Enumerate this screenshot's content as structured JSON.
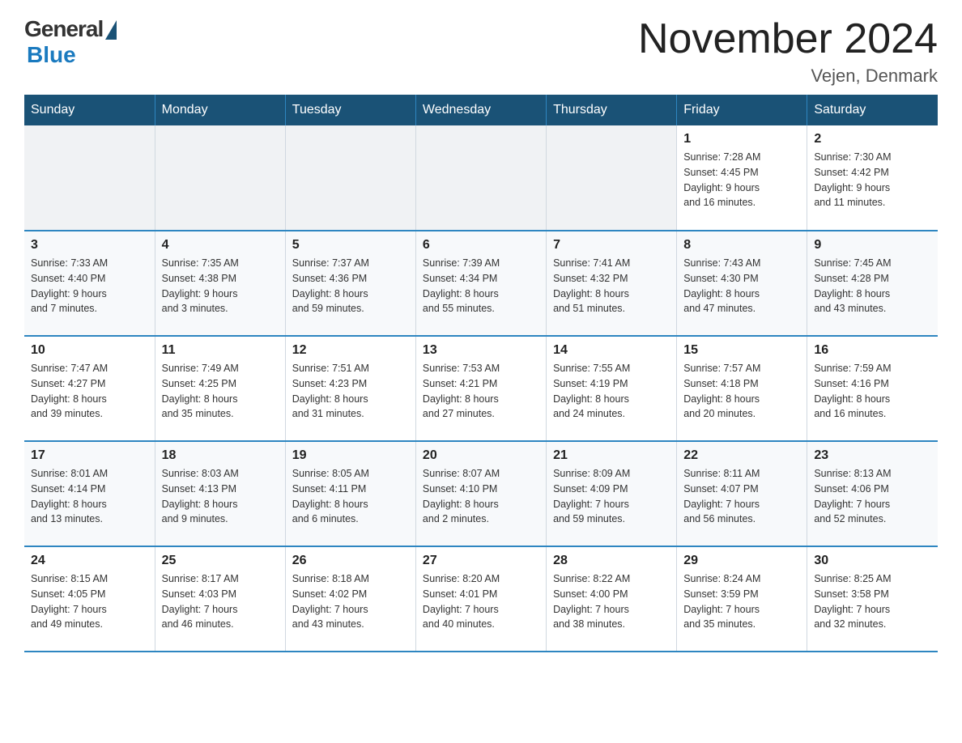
{
  "header": {
    "logo_general": "General",
    "logo_blue": "Blue",
    "title": "November 2024",
    "location": "Vejen, Denmark"
  },
  "days_of_week": [
    "Sunday",
    "Monday",
    "Tuesday",
    "Wednesday",
    "Thursday",
    "Friday",
    "Saturday"
  ],
  "weeks": [
    [
      {
        "day": "",
        "info": ""
      },
      {
        "day": "",
        "info": ""
      },
      {
        "day": "",
        "info": ""
      },
      {
        "day": "",
        "info": ""
      },
      {
        "day": "",
        "info": ""
      },
      {
        "day": "1",
        "info": "Sunrise: 7:28 AM\nSunset: 4:45 PM\nDaylight: 9 hours\nand 16 minutes."
      },
      {
        "day": "2",
        "info": "Sunrise: 7:30 AM\nSunset: 4:42 PM\nDaylight: 9 hours\nand 11 minutes."
      }
    ],
    [
      {
        "day": "3",
        "info": "Sunrise: 7:33 AM\nSunset: 4:40 PM\nDaylight: 9 hours\nand 7 minutes."
      },
      {
        "day": "4",
        "info": "Sunrise: 7:35 AM\nSunset: 4:38 PM\nDaylight: 9 hours\nand 3 minutes."
      },
      {
        "day": "5",
        "info": "Sunrise: 7:37 AM\nSunset: 4:36 PM\nDaylight: 8 hours\nand 59 minutes."
      },
      {
        "day": "6",
        "info": "Sunrise: 7:39 AM\nSunset: 4:34 PM\nDaylight: 8 hours\nand 55 minutes."
      },
      {
        "day": "7",
        "info": "Sunrise: 7:41 AM\nSunset: 4:32 PM\nDaylight: 8 hours\nand 51 minutes."
      },
      {
        "day": "8",
        "info": "Sunrise: 7:43 AM\nSunset: 4:30 PM\nDaylight: 8 hours\nand 47 minutes."
      },
      {
        "day": "9",
        "info": "Sunrise: 7:45 AM\nSunset: 4:28 PM\nDaylight: 8 hours\nand 43 minutes."
      }
    ],
    [
      {
        "day": "10",
        "info": "Sunrise: 7:47 AM\nSunset: 4:27 PM\nDaylight: 8 hours\nand 39 minutes."
      },
      {
        "day": "11",
        "info": "Sunrise: 7:49 AM\nSunset: 4:25 PM\nDaylight: 8 hours\nand 35 minutes."
      },
      {
        "day": "12",
        "info": "Sunrise: 7:51 AM\nSunset: 4:23 PM\nDaylight: 8 hours\nand 31 minutes."
      },
      {
        "day": "13",
        "info": "Sunrise: 7:53 AM\nSunset: 4:21 PM\nDaylight: 8 hours\nand 27 minutes."
      },
      {
        "day": "14",
        "info": "Sunrise: 7:55 AM\nSunset: 4:19 PM\nDaylight: 8 hours\nand 24 minutes."
      },
      {
        "day": "15",
        "info": "Sunrise: 7:57 AM\nSunset: 4:18 PM\nDaylight: 8 hours\nand 20 minutes."
      },
      {
        "day": "16",
        "info": "Sunrise: 7:59 AM\nSunset: 4:16 PM\nDaylight: 8 hours\nand 16 minutes."
      }
    ],
    [
      {
        "day": "17",
        "info": "Sunrise: 8:01 AM\nSunset: 4:14 PM\nDaylight: 8 hours\nand 13 minutes."
      },
      {
        "day": "18",
        "info": "Sunrise: 8:03 AM\nSunset: 4:13 PM\nDaylight: 8 hours\nand 9 minutes."
      },
      {
        "day": "19",
        "info": "Sunrise: 8:05 AM\nSunset: 4:11 PM\nDaylight: 8 hours\nand 6 minutes."
      },
      {
        "day": "20",
        "info": "Sunrise: 8:07 AM\nSunset: 4:10 PM\nDaylight: 8 hours\nand 2 minutes."
      },
      {
        "day": "21",
        "info": "Sunrise: 8:09 AM\nSunset: 4:09 PM\nDaylight: 7 hours\nand 59 minutes."
      },
      {
        "day": "22",
        "info": "Sunrise: 8:11 AM\nSunset: 4:07 PM\nDaylight: 7 hours\nand 56 minutes."
      },
      {
        "day": "23",
        "info": "Sunrise: 8:13 AM\nSunset: 4:06 PM\nDaylight: 7 hours\nand 52 minutes."
      }
    ],
    [
      {
        "day": "24",
        "info": "Sunrise: 8:15 AM\nSunset: 4:05 PM\nDaylight: 7 hours\nand 49 minutes."
      },
      {
        "day": "25",
        "info": "Sunrise: 8:17 AM\nSunset: 4:03 PM\nDaylight: 7 hours\nand 46 minutes."
      },
      {
        "day": "26",
        "info": "Sunrise: 8:18 AM\nSunset: 4:02 PM\nDaylight: 7 hours\nand 43 minutes."
      },
      {
        "day": "27",
        "info": "Sunrise: 8:20 AM\nSunset: 4:01 PM\nDaylight: 7 hours\nand 40 minutes."
      },
      {
        "day": "28",
        "info": "Sunrise: 8:22 AM\nSunset: 4:00 PM\nDaylight: 7 hours\nand 38 minutes."
      },
      {
        "day": "29",
        "info": "Sunrise: 8:24 AM\nSunset: 3:59 PM\nDaylight: 7 hours\nand 35 minutes."
      },
      {
        "day": "30",
        "info": "Sunrise: 8:25 AM\nSunset: 3:58 PM\nDaylight: 7 hours\nand 32 minutes."
      }
    ]
  ]
}
